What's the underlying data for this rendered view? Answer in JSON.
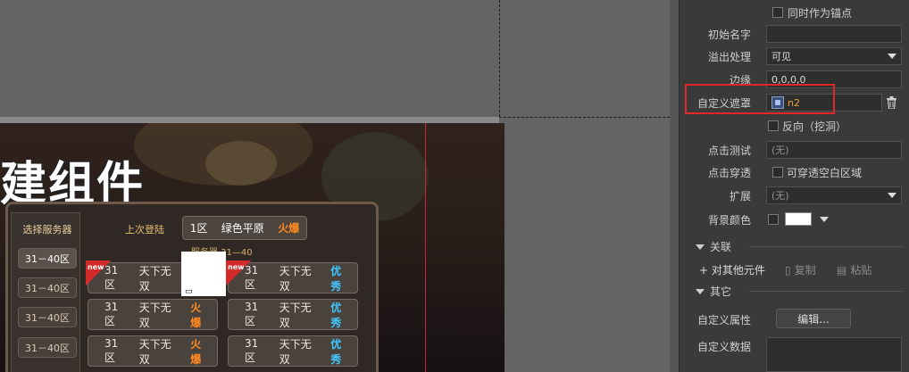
{
  "canvas": {
    "big_title": "建组件",
    "server_list_title": "选择服务器",
    "server_tabs": [
      "31－40区",
      "31－40区",
      "31－40区",
      "31－40区"
    ],
    "last_login_label": "上次登陆",
    "last_login": {
      "zone": "1区",
      "name": "绿色平原",
      "status": "火爆"
    },
    "group_label": "服务器 31—40",
    "servers": [
      {
        "zone": "31区",
        "name": "天下无双",
        "status": "火爆",
        "new": true
      },
      {
        "zone": "31区",
        "name": "天下无双",
        "status": "优秀",
        "new": true
      },
      {
        "zone": "31区",
        "name": "天下无双",
        "status": "火爆",
        "new": false
      },
      {
        "zone": "31区",
        "name": "天下无双",
        "status": "优秀",
        "new": false
      },
      {
        "zone": "31区",
        "name": "天下无双",
        "status": "火爆",
        "new": false
      },
      {
        "zone": "31区",
        "name": "天下无双",
        "status": "优秀",
        "new": false
      }
    ],
    "new_badge": "new"
  },
  "inspector": {
    "anchor_checkbox_label": "同时作为锚点",
    "initial_name_label": "初始名字",
    "initial_name_value": "",
    "overflow_label": "溢出处理",
    "overflow_value": "可见",
    "margin_label": "边缘",
    "margin_value": "0,0,0,0",
    "mask_label": "自定义遮罩",
    "mask_value": "n2",
    "reverse_label": "反向（挖洞）",
    "hit_test_label": "点击测试",
    "hit_test_value": "(无)",
    "click_through_label": "点击穿透",
    "click_through_check": "可穿透空白区域",
    "extend_label": "扩展",
    "extend_value": "(无)",
    "bg_color_label": "背景颜色",
    "bg_color": "#ffffff",
    "section_relation": "关联",
    "relate_other": "+ 对其他元件",
    "copy": "复制",
    "paste": "粘贴",
    "section_other": "其它",
    "custom_attr_label": "自定义属性",
    "edit_button": "编辑...",
    "custom_data_label": "自定义数据"
  },
  "colors": {
    "highlight": "#e02828",
    "mask_value": "#f0a030",
    "hot": "#ff8a20",
    "good": "#40c8ff"
  }
}
